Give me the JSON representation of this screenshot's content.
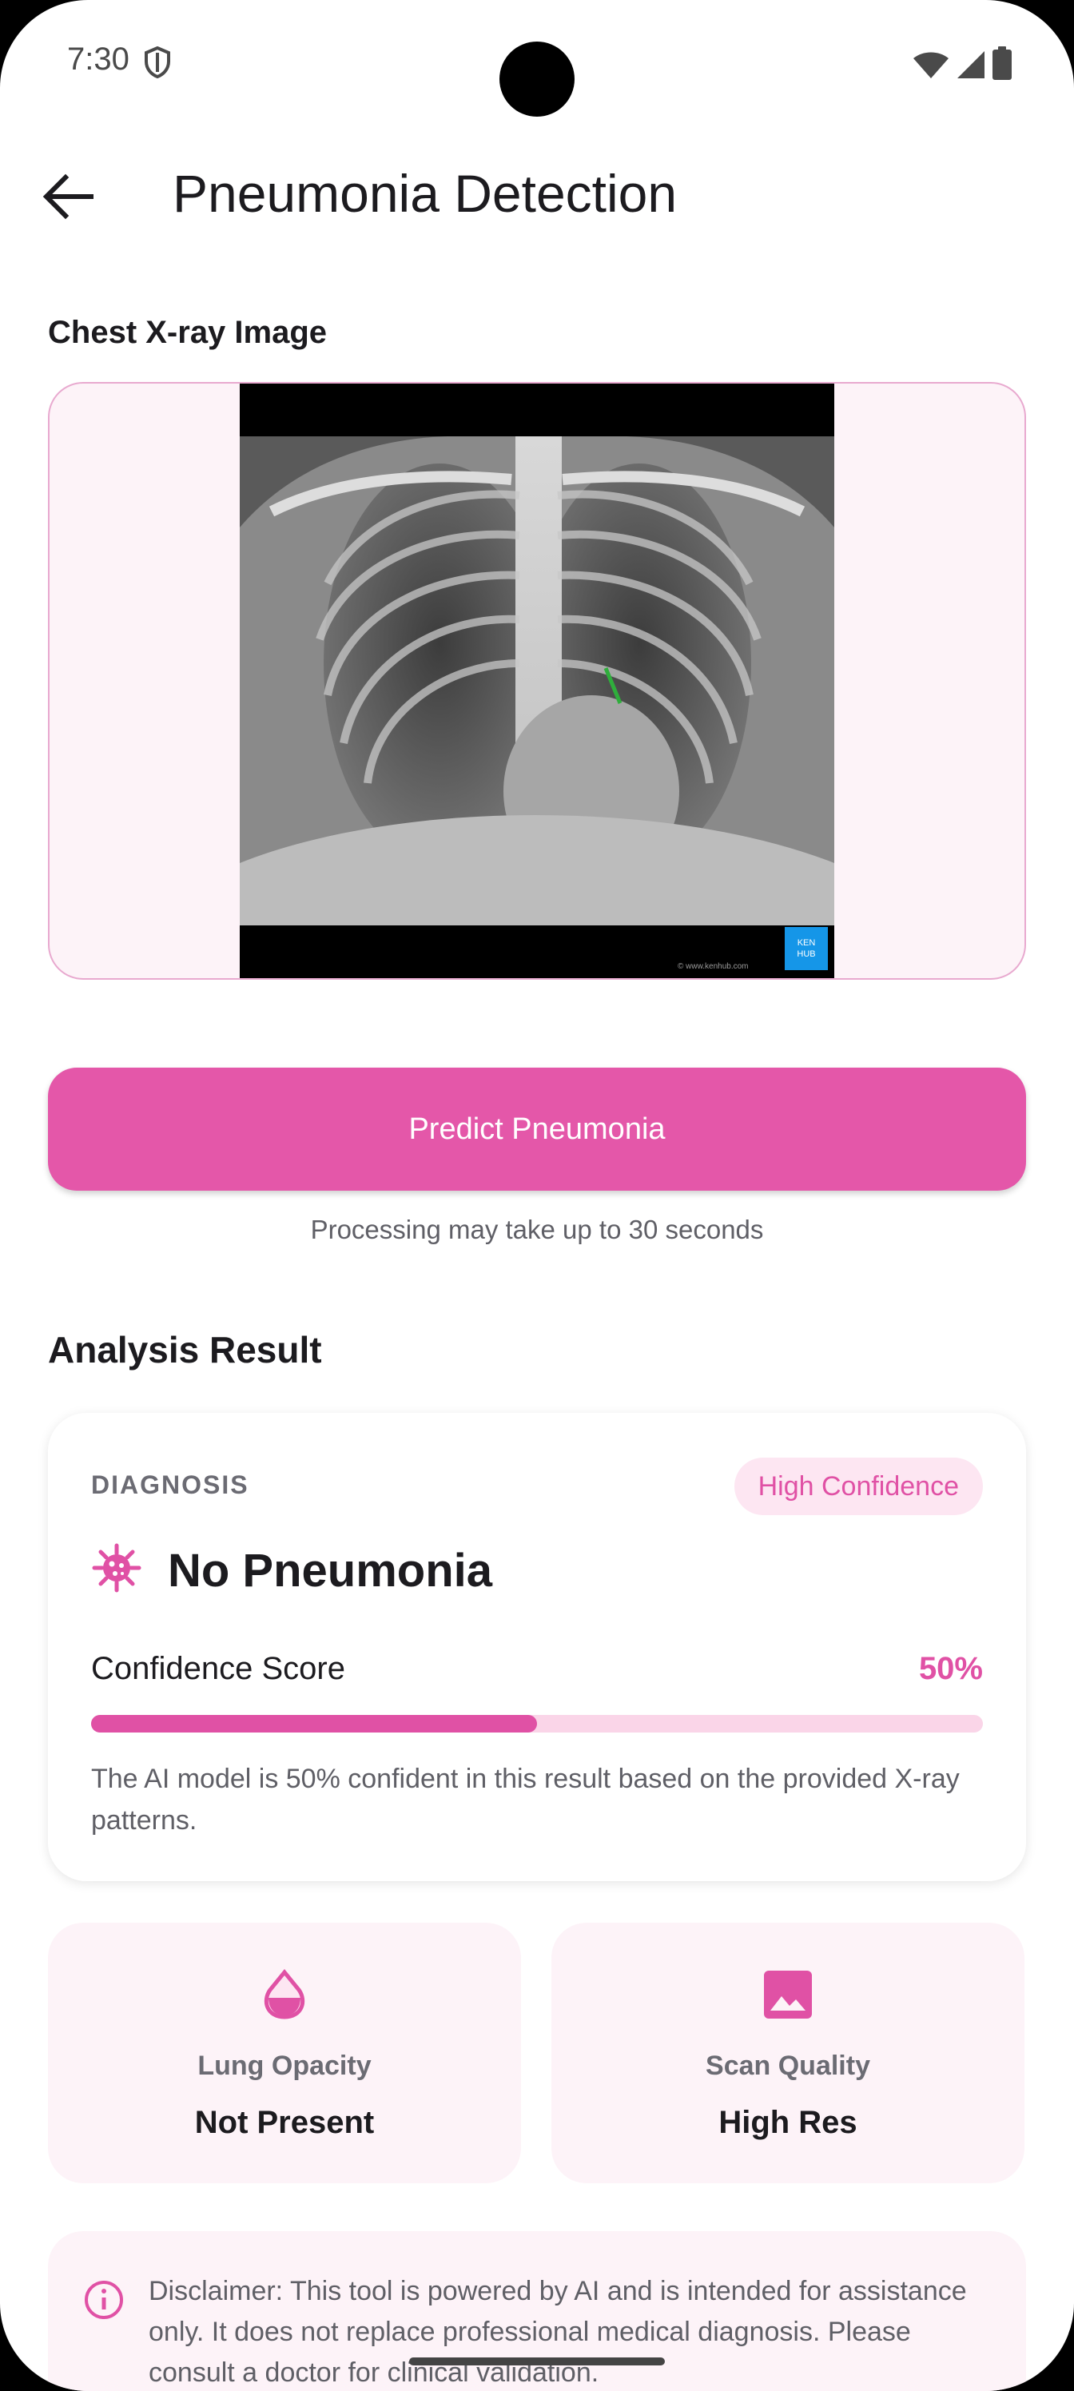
{
  "status_bar": {
    "time": "7:30"
  },
  "app_bar": {
    "title": "Pneumonia Detection"
  },
  "image_section": {
    "label": "Chest X-ray Image",
    "watermark_url": "© www.kenhub.com",
    "logo_text_1": "KEN",
    "logo_text_2": "HUB"
  },
  "predict": {
    "button_label": "Predict Pneumonia",
    "note": "Processing may take up to 30 seconds"
  },
  "result": {
    "heading": "Analysis Result",
    "diagnosis_label": "DIAGNOSIS",
    "confidence_badge": "High Confidence",
    "diagnosis_value": "No Pneumonia",
    "confidence_label": "Confidence Score",
    "confidence_value": "50%",
    "confidence_fraction": 0.5,
    "description": "The AI model is 50% confident in this result based on the provided X-ray patterns."
  },
  "stats": [
    {
      "label": "Lung Opacity",
      "value": "Not Present",
      "icon": "water-drop-icon"
    },
    {
      "label": "Scan Quality",
      "value": "High Res",
      "icon": "image-icon"
    }
  ],
  "disclaimer": {
    "text": "Disclaimer: This tool is powered by AI and is intended for assistance only. It does not replace professional medical diagnosis. Please consult a doctor for clinical validation."
  },
  "colors": {
    "accent": "#e457a9",
    "accent_light": "#fad5e8",
    "card_tint": "#fdf3f8"
  }
}
